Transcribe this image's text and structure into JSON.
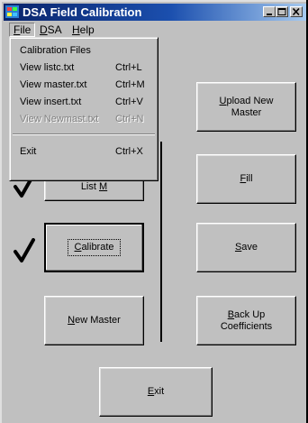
{
  "window": {
    "title": "DSA Field Calibration"
  },
  "menubar": {
    "items": [
      {
        "label": "File",
        "underline": "F"
      },
      {
        "label": "DSA",
        "underline": "D"
      },
      {
        "label": "Help",
        "underline": "H"
      }
    ]
  },
  "file_menu": {
    "items": [
      {
        "label": "Calibration Files",
        "shortcut": "",
        "enabled": true
      },
      {
        "label": "View listc.txt",
        "shortcut": "Ctrl+L",
        "enabled": true
      },
      {
        "label": "View master.txt",
        "shortcut": "Ctrl+M",
        "enabled": true
      },
      {
        "label": "View insert.txt",
        "shortcut": "Ctrl+V",
        "enabled": true
      },
      {
        "label": "View Newmast.txt",
        "shortcut": "Ctrl+N",
        "enabled": false
      }
    ],
    "exit": {
      "label": "Exit",
      "shortcut": "Ctrl+X"
    }
  },
  "buttons": {
    "list_m": {
      "label_pre": "List ",
      "label_ul": "M",
      "label_post": ""
    },
    "calibrate": {
      "label_pre": "",
      "label_ul": "C",
      "label_post": "alibrate"
    },
    "new_master": {
      "label_pre": "",
      "label_ul": "N",
      "label_post": "ew Master"
    },
    "upload": {
      "line1_ul": "U",
      "line1_post": "pload New",
      "line2": "Master"
    },
    "fill": {
      "label_pre": "",
      "label_ul": "F",
      "label_post": "ill"
    },
    "save": {
      "label_pre": "",
      "label_ul": "S",
      "label_post": "ave"
    },
    "backup": {
      "line1_ul": "B",
      "line1_post": "ack Up",
      "line2": "Coefficients"
    },
    "exit": {
      "label_pre": "",
      "label_ul": "E",
      "label_post": "xit"
    }
  },
  "checkmarks": [
    "list-m",
    "calibrate"
  ],
  "colors": {
    "face": "#c0c0c0",
    "title_start": "#0a246a",
    "title_end": "#a6caf0",
    "disabled_text": "#808080"
  }
}
